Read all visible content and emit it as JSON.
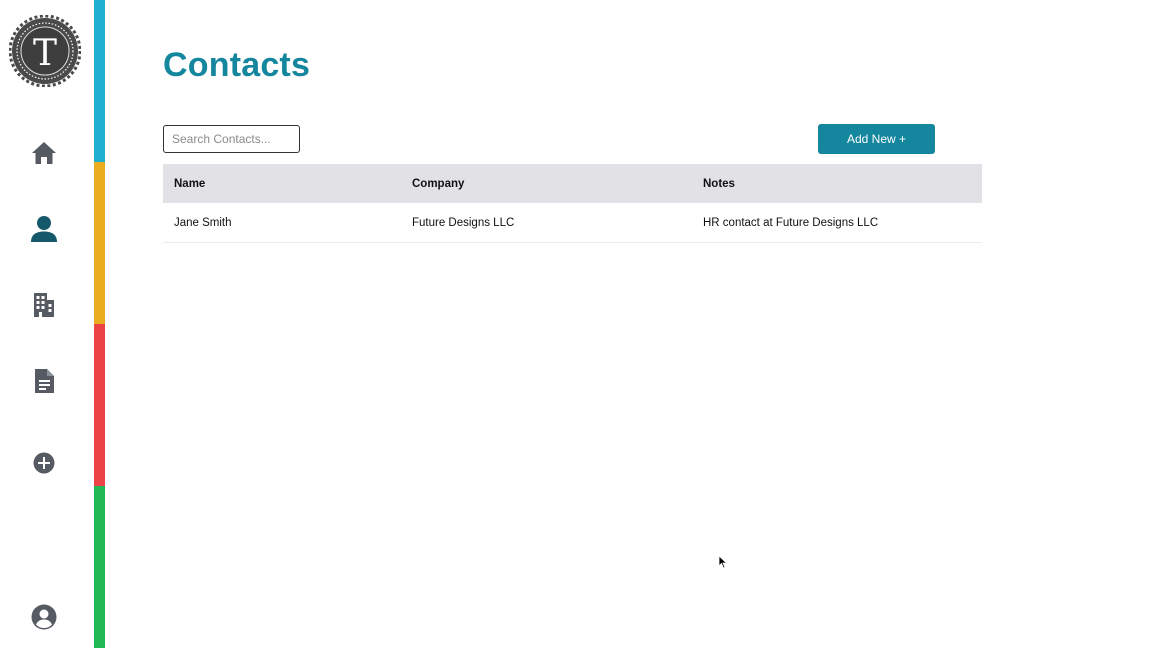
{
  "sidebar": {
    "logo_letter": "T",
    "nav": [
      {
        "name": "home",
        "icon": "home-icon"
      },
      {
        "name": "contacts",
        "icon": "person-icon"
      },
      {
        "name": "companies",
        "icon": "building-icon"
      },
      {
        "name": "documents",
        "icon": "document-icon"
      },
      {
        "name": "add",
        "icon": "plus-circle-icon"
      },
      {
        "name": "account",
        "icon": "account-circle-icon"
      }
    ],
    "strip_colors": [
      "#1fb0cf",
      "#e9ad1f",
      "#ec4346",
      "#20b955"
    ]
  },
  "page": {
    "title": "Contacts"
  },
  "toolbar": {
    "search_placeholder": "Search Contacts...",
    "search_value": "",
    "add_label": "Add New +"
  },
  "table": {
    "headers": {
      "name": "Name",
      "company": "Company",
      "notes": "Notes"
    },
    "rows": [
      {
        "name": "Jane Smith",
        "company": "Future Designs LLC",
        "notes": "HR contact at Future Designs LLC"
      }
    ]
  },
  "colors": {
    "accent": "#14869e",
    "icon": "#555a63",
    "header_bg": "#e2e2e6"
  }
}
